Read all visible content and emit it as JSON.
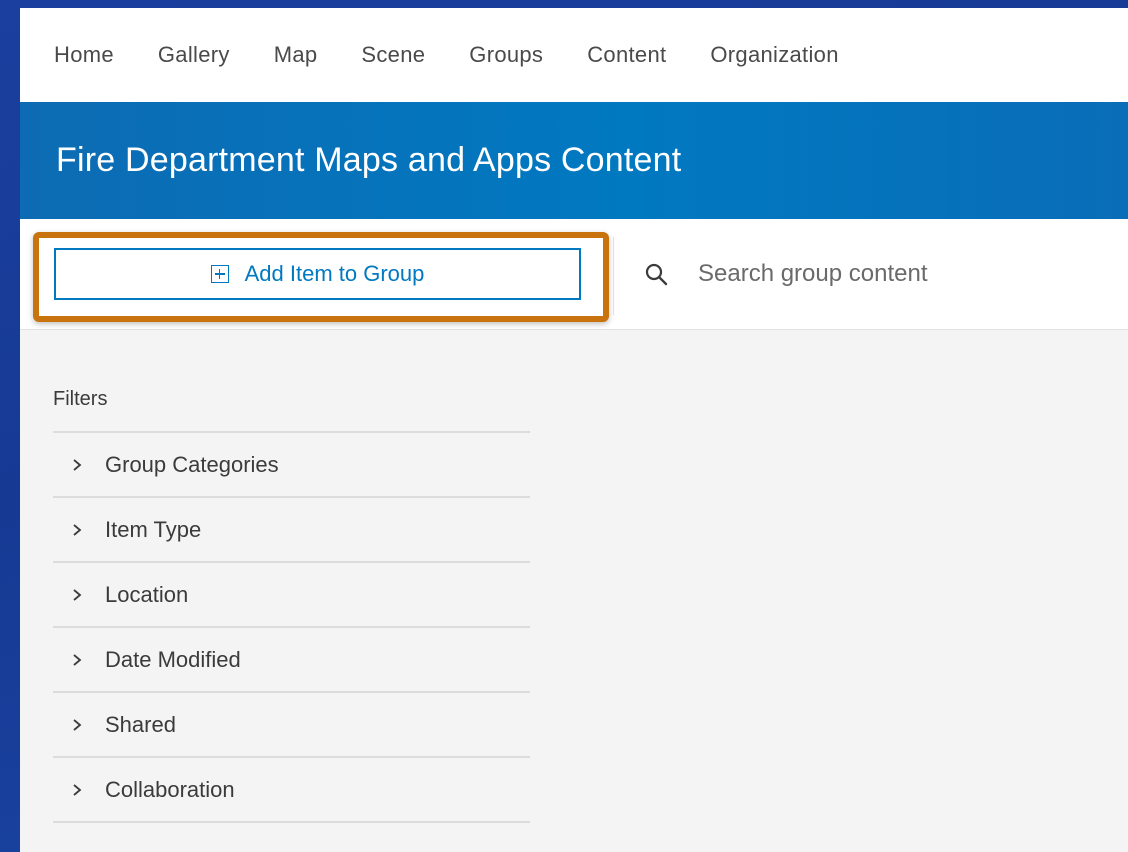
{
  "nav": {
    "items": [
      "Home",
      "Gallery",
      "Map",
      "Scene",
      "Groups",
      "Content",
      "Organization"
    ]
  },
  "banner": {
    "title": "Fire Department Maps and Apps Content"
  },
  "toolbar": {
    "add_button_label": "Add Item to Group",
    "search_placeholder": "Search group content",
    "accent_color": "#0079c1",
    "highlight_color": "#c8730e"
  },
  "filters": {
    "title": "Filters",
    "items": [
      "Group Categories",
      "Item Type",
      "Location",
      "Date Modified",
      "Shared",
      "Collaboration"
    ]
  },
  "icons": {
    "add": "plus-square-icon",
    "search": "search-icon",
    "expand": "chevron-right-icon"
  }
}
